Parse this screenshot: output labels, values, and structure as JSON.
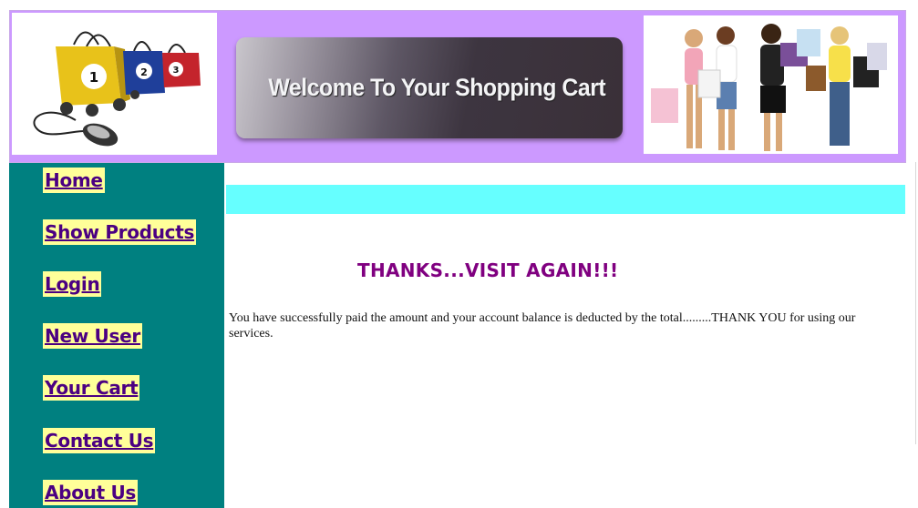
{
  "header": {
    "banner_text": "Welcome To Your Shopping Cart",
    "logo_bag_numbers": [
      "1",
      "2",
      "3"
    ]
  },
  "sidebar": {
    "items": [
      {
        "label": "Home"
      },
      {
        "label": "Show Products"
      },
      {
        "label": "Login"
      },
      {
        "label": "New User"
      },
      {
        "label": "Your Cart"
      },
      {
        "label": "Contact Us"
      },
      {
        "label": "About Us"
      }
    ]
  },
  "main": {
    "heading": "THANKS...VISIT AGAIN!!!",
    "message": "You have successfully paid the amount and your account balance is deducted by the total.........THANK YOU for using our services."
  },
  "colors": {
    "header_bg": "#cc99ff",
    "sidebar_bg": "#008080",
    "nav_bg": "#ffff99",
    "nav_text": "#4b0082",
    "cyan_bar": "#66ffff",
    "heading": "#800080"
  }
}
